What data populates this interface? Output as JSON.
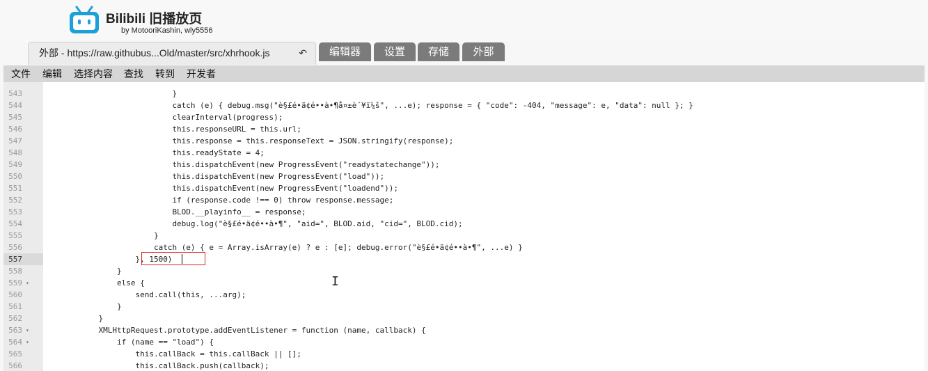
{
  "header": {
    "title": "Bilibili 旧播放页",
    "subtitle": "by MotooriKashin, wly5556"
  },
  "tabs": {
    "active": {
      "label": "外部 - https://raw.githubus...Old/master/src/xhrhook.js",
      "undo_icon": "↶"
    },
    "items": [
      "编辑器",
      "设置",
      "存储",
      "外部"
    ]
  },
  "menu": [
    "文件",
    "编辑",
    "选择内容",
    "查找",
    "转到",
    "开发者"
  ],
  "editor": {
    "active_line": 557,
    "lines": [
      {
        "no": "543",
        "fold": "",
        "indent": "                            ",
        "code": "}"
      },
      {
        "no": "544",
        "fold": "",
        "indent": "                            ",
        "code": "catch (e) { debug.msg(\"è§£é•ä¢é••à•¶å¤±è´¥ï¼š\", ...e); response = { \"code\": -404, \"message\": e, \"data\": null }; }"
      },
      {
        "no": "545",
        "fold": "",
        "indent": "                            ",
        "code": "clearInterval(progress);"
      },
      {
        "no": "546",
        "fold": "",
        "indent": "                            ",
        "code": "this.responseURL = this.url;"
      },
      {
        "no": "547",
        "fold": "",
        "indent": "                            ",
        "code": "this.response = this.responseText = JSON.stringify(response);"
      },
      {
        "no": "548",
        "fold": "",
        "indent": "                            ",
        "code": "this.readyState = 4;"
      },
      {
        "no": "549",
        "fold": "",
        "indent": "                            ",
        "code": "this.dispatchEvent(new ProgressEvent(\"readystatechange\"));"
      },
      {
        "no": "550",
        "fold": "",
        "indent": "                            ",
        "code": "this.dispatchEvent(new ProgressEvent(\"load\"));"
      },
      {
        "no": "551",
        "fold": "",
        "indent": "                            ",
        "code": "this.dispatchEvent(new ProgressEvent(\"loadend\"));"
      },
      {
        "no": "552",
        "fold": "",
        "indent": "                            ",
        "code": "if (response.code !== 0) throw response.message;"
      },
      {
        "no": "553",
        "fold": "",
        "indent": "                            ",
        "code": "BLOD.__playinfo__ = response;"
      },
      {
        "no": "554",
        "fold": "",
        "indent": "                            ",
        "code": "debug.log(\"è§£é•ä¢é••à•¶\", \"aid=\", BLOD.aid, \"cid=\", BLOD.cid);"
      },
      {
        "no": "555",
        "fold": "",
        "indent": "                        ",
        "code": "}"
      },
      {
        "no": "556",
        "fold": "",
        "indent": "                        ",
        "code": "catch (e) { e = Array.isArray(e) ? e : [e]; debug.error(\"è§£é•ä¢é••à•¶\", ...e) }"
      },
      {
        "no": "557",
        "fold": "",
        "indent": "                    ",
        "code": "}, 1500)"
      },
      {
        "no": "558",
        "fold": "",
        "indent": "                ",
        "code": "}"
      },
      {
        "no": "559",
        "fold": "▾",
        "indent": "                ",
        "code": "else {"
      },
      {
        "no": "560",
        "fold": "",
        "indent": "                    ",
        "code": "send.call(this, ...arg);"
      },
      {
        "no": "561",
        "fold": "",
        "indent": "                ",
        "code": "}"
      },
      {
        "no": "562",
        "fold": "",
        "indent": "            ",
        "code": "}"
      },
      {
        "no": "563",
        "fold": "▾",
        "indent": "            ",
        "code": "XMLHttpRequest.prototype.addEventListener = function (name, callback) {"
      },
      {
        "no": "564",
        "fold": "▾",
        "indent": "                ",
        "code": "if (name == \"load\") {"
      },
      {
        "no": "565",
        "fold": "",
        "indent": "                    ",
        "code": "this.callBack = this.callBack || [];"
      },
      {
        "no": "566",
        "fold": "",
        "indent": "                    ",
        "code": "this.callBack.push(callback);"
      }
    ]
  }
}
